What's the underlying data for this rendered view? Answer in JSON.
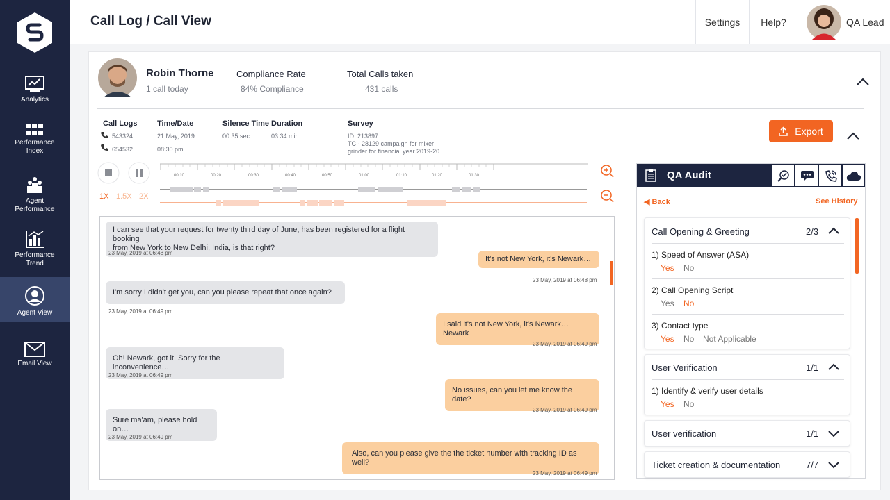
{
  "header": {
    "title": "Call Log / Call View",
    "settings": "Settings",
    "help": "Help?",
    "user": "QA Lead"
  },
  "sidebar": {
    "items": [
      {
        "label": "Analytics",
        "icon": "analytics-icon"
      },
      {
        "label": "Performance Index",
        "icon": "grid-icon"
      },
      {
        "label": "Agent Performance",
        "icon": "agents-icon"
      },
      {
        "label": "Performance Trend",
        "icon": "trend-icon"
      },
      {
        "label": "Agent View",
        "icon": "user-icon"
      },
      {
        "label": "Email View",
        "icon": "envelope-icon"
      }
    ]
  },
  "agent": {
    "name": "Robin Thorne",
    "calls_today": "1 call today",
    "compliance_label": "Compliance Rate",
    "compliance_value": "84% Compliance",
    "total_label": "Total Calls taken",
    "total_value": "431 calls"
  },
  "details": {
    "call_logs_label": "Call Logs",
    "call_logs": [
      "543324",
      "654532"
    ],
    "time_label": "Time/Date",
    "date": "21 May, 2019",
    "time": "08:30 pm",
    "silence_label": "Silence Time",
    "silence": "00:35 sec",
    "duration_label": "Duration",
    "duration": "03:34 min",
    "survey_label": "Survey",
    "survey_id": "ID: 213897",
    "survey_line1": "TC - 28129 campaign for mixer",
    "survey_line2": "grinder for financial year 2019-20",
    "export": "Export"
  },
  "player": {
    "speeds": [
      "1X",
      "1.5X",
      "2X"
    ],
    "ticks": [
      "00:10",
      "00:20",
      "00:30",
      "00:40",
      "00:50",
      "01:00",
      "01:10",
      "01:20",
      "01:30"
    ]
  },
  "chat": [
    {
      "side": "left",
      "line1": "I can see that your request for twenty third day of June, has been registered for a flight booking",
      "line2": "from New York to New Delhi, India, is that right?",
      "time": "23 May, 2019 at 06:48 pm"
    },
    {
      "side": "right",
      "line1": "It's not New York, it's Newark…",
      "time": "23 May, 2019 at 06:48 pm"
    },
    {
      "side": "left",
      "line1": "I'm sorry I didn't get you, can you please repeat that once again?",
      "time": "23 May, 2019 at 06:49 pm"
    },
    {
      "side": "right",
      "line1": "I said it's not New York, it's Newark…Newark",
      "time": "23 May, 2019 at 06:49 pm"
    },
    {
      "side": "left",
      "line1": "Oh! Newark, got it. Sorry for the inconvenience…",
      "time": "23 May, 2019 at 06:49 pm"
    },
    {
      "side": "right",
      "line1": "No issues, can you let me know the date?",
      "time": "23 May, 2019 at 06:49 pm"
    },
    {
      "side": "left",
      "line1": "Sure ma'am, please hold on…",
      "time": "23 May, 2019 at 06:49 pm"
    },
    {
      "side": "right",
      "line1": "Also, can you please give the the ticket number with tracking ID as well?",
      "time": "23 May, 2019 at 06:49 pm"
    }
  ],
  "qa": {
    "title": "QA Audit",
    "back": "Back",
    "history": "See History",
    "sections": [
      {
        "title": "Call Opening & Greeting",
        "count": "2/3",
        "questions": [
          {
            "q": "1) Speed of Answer (ASA)",
            "options": [
              "Yes",
              "No"
            ]
          },
          {
            "q": "2) Call Opening Script",
            "options": [
              "Yes",
              "No"
            ]
          },
          {
            "q": "3) Contact type",
            "options": [
              "Yes",
              "No",
              "Not Applicable"
            ]
          }
        ]
      },
      {
        "title": "User Verification",
        "count": "1/1",
        "questions": [
          {
            "q": "1) Identify & verify user details",
            "options": [
              "Yes",
              "No"
            ]
          }
        ]
      },
      {
        "title": "User verification",
        "count": "1/1"
      },
      {
        "title": "Ticket creation & documentation",
        "count": "7/7"
      }
    ]
  },
  "colors": {
    "accent": "#f26522",
    "sidebar": "#1d2540",
    "bubble_right": "#fbcf9f",
    "bubble_left": "#e4e5e8"
  }
}
